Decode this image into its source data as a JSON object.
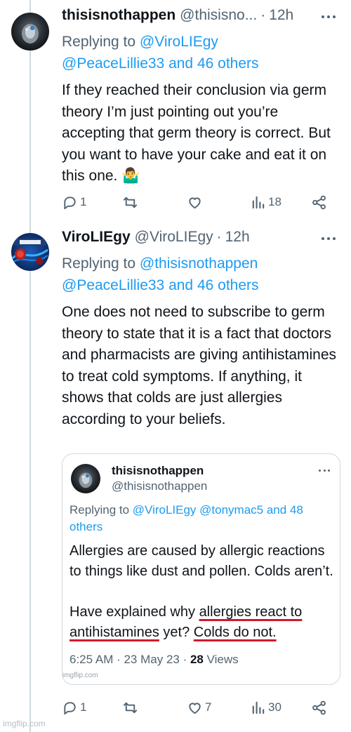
{
  "tweet1": {
    "display_name": "thisisnothappen",
    "handle": "@thisisno...",
    "dot": "·",
    "time": "12h",
    "replying_prefix": "Replying to ",
    "replying_mention_1": "@ViroLIEgy",
    "replying_mention_2": "@PeaceLillie33 and 46 others",
    "text": "If they reached their conclusion via germ theory I’m just pointing out you’re accepting that germ theory is correct. But you want to have your cake and eat it on this one. 🤷‍♂️",
    "actions": {
      "replies": "1",
      "retweets": "",
      "likes": "",
      "views": "18"
    }
  },
  "tweet2": {
    "display_name": "ViroLIEgy",
    "handle": "@ViroLIEgy",
    "dot": "·",
    "time": "12h",
    "replying_prefix": "Replying to ",
    "replying_mention_1": "@thisisnothappen",
    "replying_mention_2": "@PeaceLillie33 and 46 others",
    "text": "One does not need to subscribe to germ theory to state that it is a fact that doctors and pharmacists are giving antihistamines to treat cold symptoms. If anything, it shows that colds are just allergies according to your beliefs.",
    "actions": {
      "replies": "1",
      "retweets": "",
      "likes": "7",
      "views": "30"
    }
  },
  "quoted": {
    "display_name": "thisisnothappen",
    "handle": "@thisisnothappen",
    "replying_prefix": "Replying to ",
    "replying_mentions": "@ViroLIEgy @tonymac5 and 48 others",
    "text_p1": "Allergies are caused by allergic reactions to things like dust and pollen. Colds aren’t.",
    "text_p2_a": "Have explained why ",
    "text_p2_b": "allergies react to antihistamines",
    "text_p2_c": " yet? ",
    "text_p2_d": "Colds do not.",
    "meta_time": "6:25 AM · 23 May 23 · ",
    "meta_views_count": "28",
    "meta_views_label": " Views",
    "watermark": "imgflip.com"
  },
  "watermark": "imgflip.com",
  "colors": {
    "accent": "#1d9bf0",
    "muted": "#536471",
    "underline": "#d11a2a",
    "text": "#0f1419"
  },
  "icons": [
    "more-icon",
    "reply-icon",
    "retweet-icon",
    "like-icon",
    "views-icon",
    "share-icon"
  ]
}
